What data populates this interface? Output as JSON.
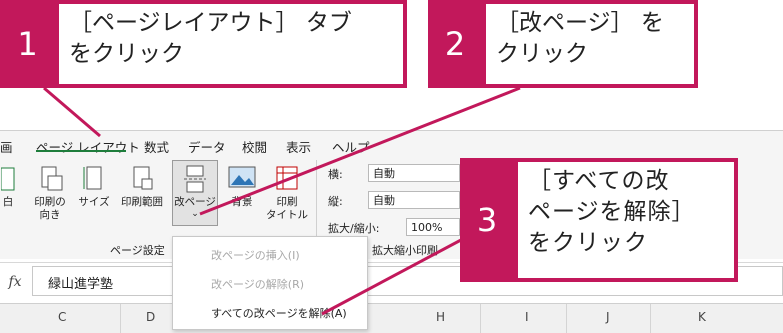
{
  "ribbon": {
    "tabs": [
      {
        "id": "partial",
        "label": "画"
      },
      {
        "id": "page-layout",
        "label": "ページ レイアウト"
      },
      {
        "id": "formulas",
        "label": "数式"
      },
      {
        "id": "data",
        "label": "データ"
      },
      {
        "id": "review",
        "label": "校閲"
      },
      {
        "id": "view",
        "label": "表示"
      },
      {
        "id": "help",
        "label": "ヘルプ"
      }
    ],
    "buttons": {
      "partial_left": "白",
      "print_orientation": "印刷の\n向き",
      "size": "サイズ",
      "print_area": "印刷範囲",
      "page_break": "改ページ",
      "background": "背景",
      "print_titles": "印刷\nタイトル"
    },
    "group_label_page_setup": "ページ設定",
    "group_label_scale": "拡大縮小印刷",
    "scale": {
      "width_label": "横:",
      "width_value": "自動",
      "height_label": "縦:",
      "height_value": "自動",
      "zoom_label": "拡大/縮小:",
      "zoom_value": "100%"
    }
  },
  "formula_bar": {
    "fx_label": "fx",
    "cell_content": "緑山進学塾"
  },
  "columns": [
    "C",
    "D",
    "H",
    "I",
    "J",
    "K"
  ],
  "dropdown": {
    "items": [
      {
        "label": "改ページの挿入(I)",
        "enabled": false
      },
      {
        "label": "改ページの解除(R)",
        "enabled": false
      },
      {
        "label": "すべての改ページを解除(A)",
        "enabled": true
      }
    ]
  },
  "callouts": [
    {
      "number": "1",
      "text_lines": [
        "［ページレイアウト］ タブ",
        "をクリック"
      ]
    },
    {
      "number": "2",
      "text_lines": [
        "［改ページ］ を",
        "クリック"
      ]
    },
    {
      "number": "3",
      "text_lines": [
        "［すべての改",
        "ページを解除］",
        "をクリック"
      ]
    }
  ],
  "colors": {
    "callout_accent": "#c2185b",
    "active_tab_underline": "#1e7d3c"
  }
}
